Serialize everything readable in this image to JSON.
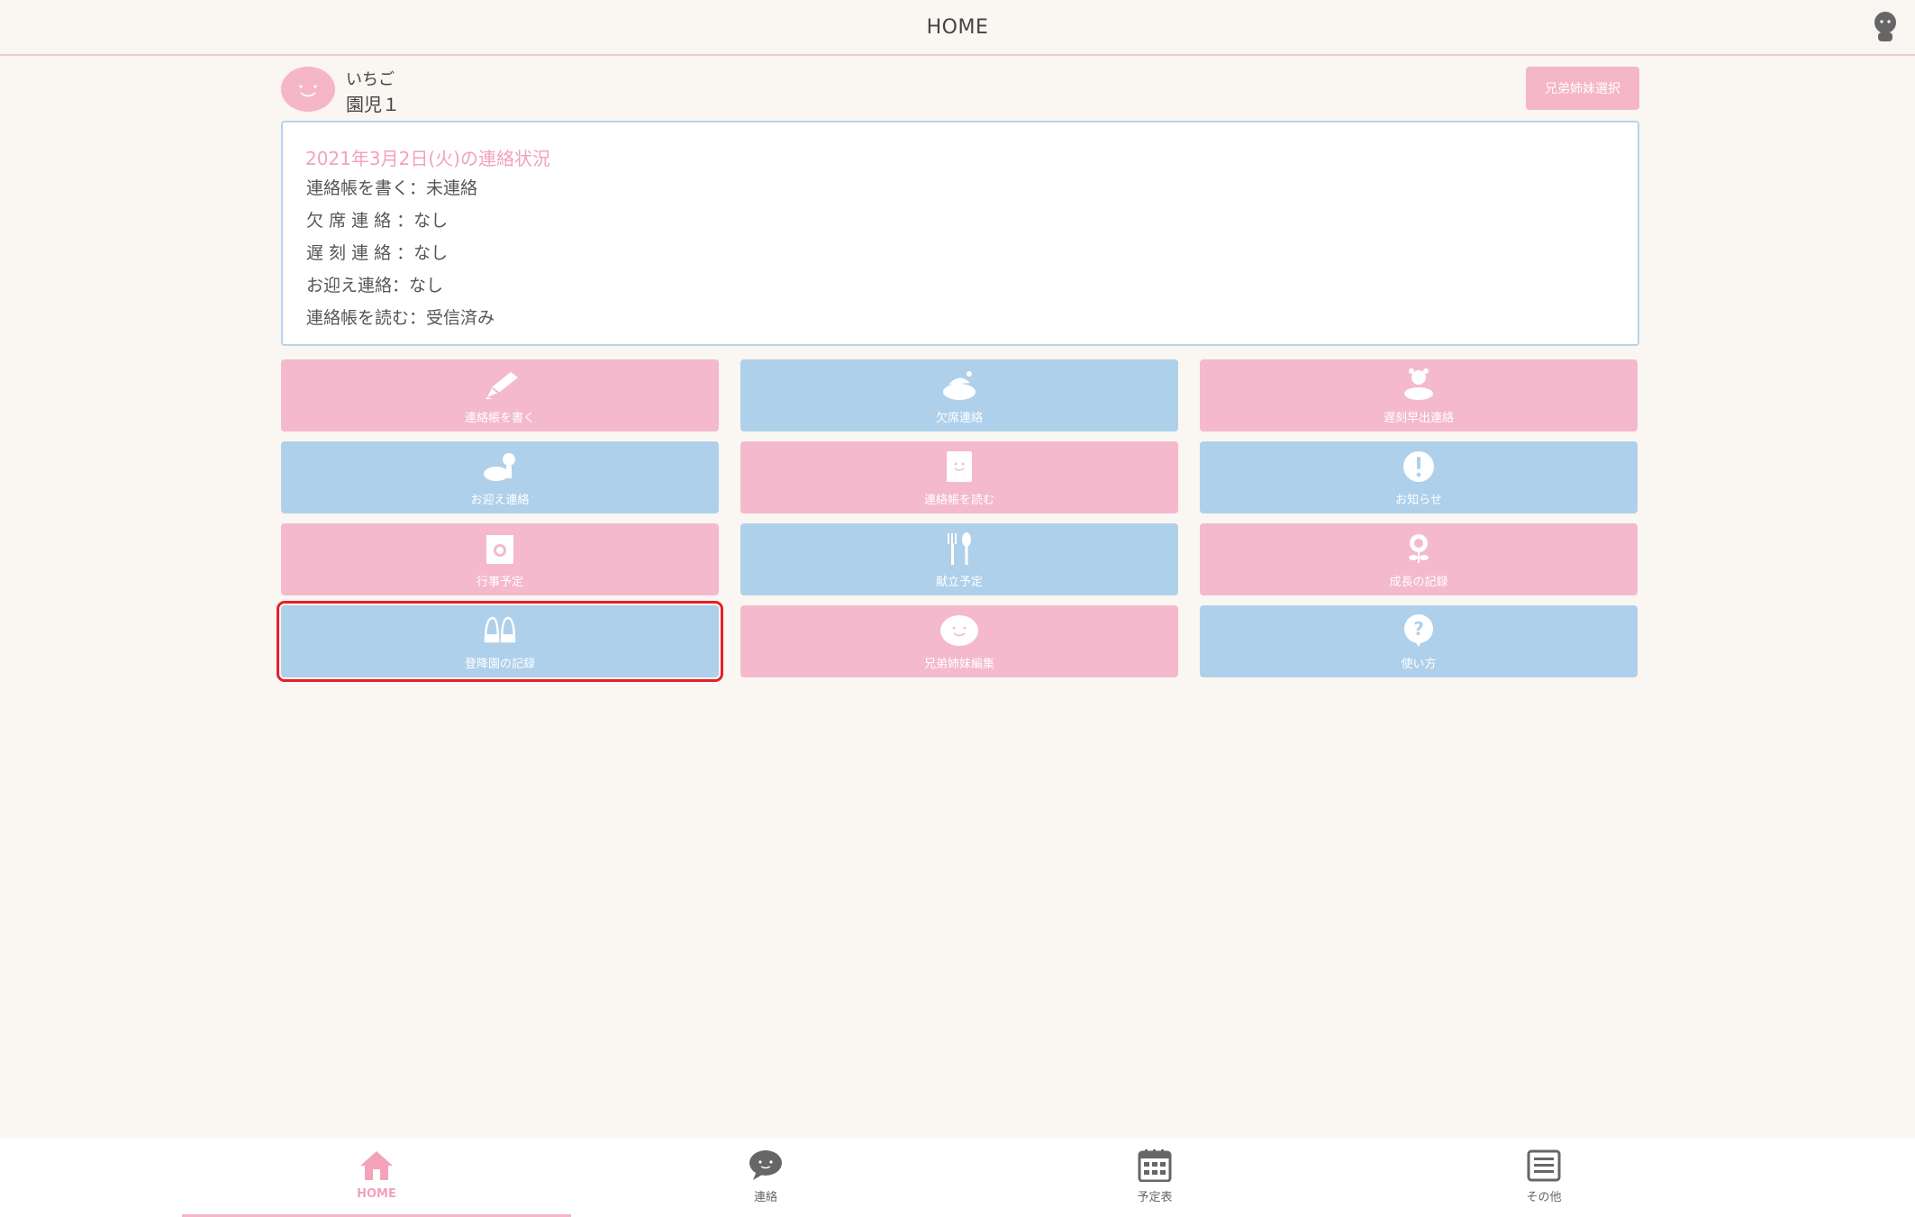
{
  "header": {
    "title": "HOME"
  },
  "child": {
    "name": "いちご",
    "class": "園児１"
  },
  "sibling_select_label": "兄弟姉妹選択",
  "status": {
    "title": "2021年3月2日(火)の連絡状況",
    "lines": [
      "連絡帳を書く：未連絡",
      "欠 席 連 絡 ：なし",
      "遅 刻 連 絡 ：なし",
      "お迎え連絡：なし",
      "連絡帳を読む：受信済み"
    ]
  },
  "tiles": [
    {
      "label": "連絡帳を書く",
      "color": "pink",
      "icon": "pencil-icon"
    },
    {
      "label": "欠席連絡",
      "color": "blue",
      "icon": "sleeping-turtle-icon"
    },
    {
      "label": "遅刻早出連絡",
      "color": "pink",
      "icon": "turtle-alarm-icon"
    },
    {
      "label": "お迎え連絡",
      "color": "blue",
      "icon": "turtle-child-icon"
    },
    {
      "label": "連絡帳を読む",
      "color": "pink",
      "icon": "notebook-icon"
    },
    {
      "label": "お知らせ",
      "color": "blue",
      "icon": "exclamation-icon"
    },
    {
      "label": "行事予定",
      "color": "pink",
      "icon": "calendar-icon"
    },
    {
      "label": "献立予定",
      "color": "blue",
      "icon": "fork-spoon-icon"
    },
    {
      "label": "成長の記録",
      "color": "pink",
      "icon": "flower-icon"
    },
    {
      "label": "登降園の記録",
      "color": "blue",
      "icon": "shoes-icon"
    },
    {
      "label": "兄弟姉妹編集",
      "color": "pink",
      "icon": "smile-icon"
    },
    {
      "label": "使い方",
      "color": "blue",
      "icon": "question-icon"
    }
  ],
  "nav": [
    {
      "label": "HOME",
      "icon": "home-icon",
      "active": true
    },
    {
      "label": "連絡",
      "icon": "chat-bubble-icon",
      "active": false
    },
    {
      "label": "予定表",
      "icon": "calendar-grid-icon",
      "active": false
    },
    {
      "label": "その他",
      "icon": "menu-list-icon",
      "active": false
    }
  ],
  "colors": {
    "pink": "#f4b9cc",
    "blue": "#afd0ea",
    "accent_pink": "#f2a2bb",
    "selection": "#e6202a"
  }
}
